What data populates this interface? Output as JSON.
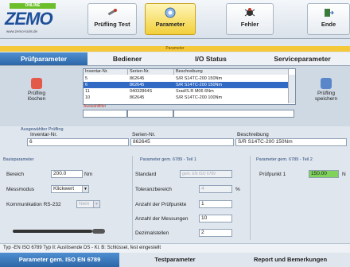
{
  "logo": {
    "badge": "ONLINE",
    "brand": "ZEMO",
    "url": "www.zemo-tools.de"
  },
  "toolbar": {
    "buttons": [
      {
        "label": "Prüfling Test",
        "icon": "test-icon"
      },
      {
        "label": "Parameter",
        "icon": "parameter-icon",
        "active": true
      },
      {
        "label": "Fehler",
        "icon": "error-icon"
      },
      {
        "label": "Ende",
        "icon": "exit-icon"
      }
    ]
  },
  "header": {
    "title": "Parameter"
  },
  "tabs": [
    "Prüfparameter",
    "Bediener",
    "I/O Status",
    "Serviceparameter"
  ],
  "side": {
    "delete_label": "Prüfling löschen",
    "save_label": "Prüfling speichern"
  },
  "grid": {
    "columns": [
      "Inventar-Nr.",
      "Serien-Nr.",
      "Beschreibung"
    ],
    "rows": [
      [
        "5",
        "862645",
        "S/R S14TC-200 150Nm"
      ],
      [
        "6",
        "862645",
        "S/R S14TC-200 150Nm"
      ],
      [
        "11",
        "04032864S",
        "Srad/S.R M06 6Nm"
      ],
      [
        "10",
        "862645",
        "S/R S14TC-200 100Nm"
      ]
    ],
    "selected_row": 1,
    "filter_label": "Auswahlfilter"
  },
  "selected": {
    "header": "Ausgewählter Prüfling",
    "inv_label": "Inventar-Nr.",
    "inv": "6",
    "sn_label": "Serien-Nr.",
    "sn": "862645",
    "desc_label": "Beschreibung",
    "desc": "S/R S14TC-200 150Nm"
  },
  "basic": {
    "header": "Basisparameter",
    "range_label": "Bereich",
    "range_value": "200.0",
    "range_unit": "Nm",
    "mode_label": "Messmodus",
    "mode_value": "Klickwert",
    "comm_label": "Kommunikation RS-232",
    "comm_value": "Nein"
  },
  "iso1": {
    "header": "Parameter gem. 6789 - Teil 1",
    "standard_label": "Standard",
    "standard_value": "gem. EN ISO 6789",
    "tol_label": "Toleranzbereich",
    "tol_value": "4",
    "tol_unit": "%",
    "points_label": "Anzahl der Prüfpunkte",
    "points_value": "1",
    "meas_label": "Anzahl der Messungen",
    "meas_value": "10",
    "dec_label": "Dezimalstellen",
    "dec_value": "2"
  },
  "iso2": {
    "header": "Parameter gem. 6789 - Teil 2",
    "p1_label": "Prüfpunkt 1",
    "p1_value": "150.00",
    "p1_unit": "N"
  },
  "type_text": "Typ -EN ISO 6789 Typ II: Auslösende DS - Kl. B: Schlüssel, fest eingestellt",
  "bottom_tabs": [
    "Parameter gem. ISO EN 6789",
    "Testparameter",
    "Report und Bemerkungen"
  ],
  "colors": {
    "accent": "#2d67a8",
    "highlight": "#f2cf3a",
    "value_green": "#7fd35a"
  }
}
